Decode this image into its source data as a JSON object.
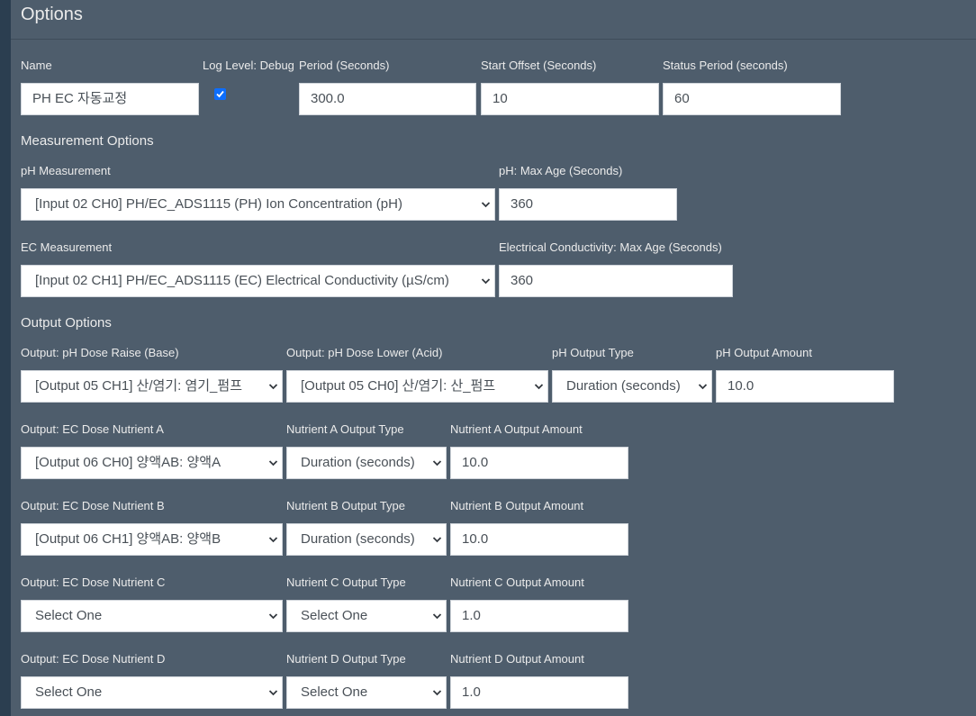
{
  "header": {
    "title": "Options"
  },
  "general": {
    "name_label": "Name",
    "name_value": "PH EC 자동교정",
    "log_level_label": "Log Level: Debug",
    "log_level_checked": true,
    "period_label": "Period (Seconds)",
    "period_value": "300.0",
    "start_offset_label": "Start Offset (Seconds)",
    "start_offset_value": "10",
    "status_period_label": "Status Period (seconds)",
    "status_period_value": "60"
  },
  "measurement": {
    "section_title": "Measurement Options",
    "ph_label": "pH Measurement",
    "ph_value": "[Input 02 CH0] PH/EC_ADS1115 (PH) Ion Concentration (pH)",
    "ph_max_age_label": "pH: Max Age (Seconds)",
    "ph_max_age_value": "360",
    "ec_label": "EC Measurement",
    "ec_value": "[Input 02 CH1] PH/EC_ADS1115 (EC) Electrical Conductivity (µS/cm)",
    "ec_max_age_label": "Electrical Conductivity: Max Age (Seconds)",
    "ec_max_age_value": "360"
  },
  "output": {
    "section_title": "Output Options",
    "ph_raise_label": "Output: pH Dose Raise (Base)",
    "ph_raise_value": "[Output 05 CH1] 산/염기: 염기_펌프",
    "ph_lower_label": "Output: pH Dose Lower (Acid)",
    "ph_lower_value": "[Output 05 CH0] 산/염기: 산_펌프",
    "ph_type_label": "pH Output Type",
    "ph_type_value": "Duration (seconds)",
    "ph_amount_label": "pH Output Amount",
    "ph_amount_value": "10.0",
    "nutrients": [
      {
        "dose_label": "Output: EC Dose Nutrient A",
        "dose_value": "[Output 06 CH0] 양액AB: 양액A",
        "type_label": "Nutrient A Output Type",
        "type_value": "Duration (seconds)",
        "amount_label": "Nutrient A Output Amount",
        "amount_value": "10.0"
      },
      {
        "dose_label": "Output: EC Dose Nutrient B",
        "dose_value": "[Output 06 CH1] 양액AB: 양액B",
        "type_label": "Nutrient B Output Type",
        "type_value": "Duration (seconds)",
        "amount_label": "Nutrient B Output Amount",
        "amount_value": "10.0"
      },
      {
        "dose_label": "Output: EC Dose Nutrient C",
        "dose_value": "Select One",
        "type_label": "Nutrient C Output Type",
        "type_value": "Select One",
        "amount_label": "Nutrient C Output Amount",
        "amount_value": "1.0"
      },
      {
        "dose_label": "Output: EC Dose Nutrient D",
        "dose_value": "Select One",
        "type_label": "Nutrient D Output Type",
        "type_value": "Select One",
        "amount_label": "Nutrient D Output Amount",
        "amount_value": "1.0"
      }
    ]
  }
}
